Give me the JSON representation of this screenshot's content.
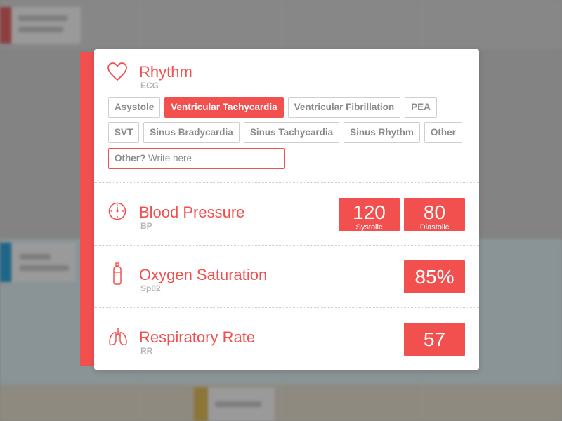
{
  "colors": {
    "accent": "#f2504f",
    "chip_text": "#8a8a8a",
    "subtitle": "#b7b7b7",
    "overlay": "#838383"
  },
  "rhythm": {
    "icon": "heart-icon",
    "title": "Rhythm",
    "subtitle": "ECG",
    "options_row1": [
      {
        "label": "Asystole",
        "selected": false
      },
      {
        "label": "Ventricular Tachycardia",
        "selected": true
      },
      {
        "label": "Ventricular Fibrillation",
        "selected": false
      },
      {
        "label": "PEA",
        "selected": false
      }
    ],
    "options_row2": [
      {
        "label": "SVT",
        "selected": false
      },
      {
        "label": "Sinus Bradycardia",
        "selected": false
      },
      {
        "label": "Sinus Tachycardia",
        "selected": false
      },
      {
        "label": "Sinus Rhythm",
        "selected": false
      },
      {
        "label": "Other",
        "selected": false
      }
    ],
    "other_input": {
      "label": "Other?",
      "placeholder": "Write here"
    }
  },
  "blood_pressure": {
    "icon": "gauge-icon",
    "title": "Blood Pressure",
    "subtitle": "BP",
    "systolic": {
      "value": "120",
      "caption": "Systolic"
    },
    "diastolic": {
      "value": "80",
      "caption": "Diastolic"
    }
  },
  "oxygen": {
    "icon": "oxygen-tank-icon",
    "title": "Oxygen Saturation",
    "subtitle": "Sp02",
    "value": "85%"
  },
  "respiratory": {
    "icon": "lungs-icon",
    "title": "Respiratory Rate",
    "subtitle": "RR",
    "value": "57"
  }
}
